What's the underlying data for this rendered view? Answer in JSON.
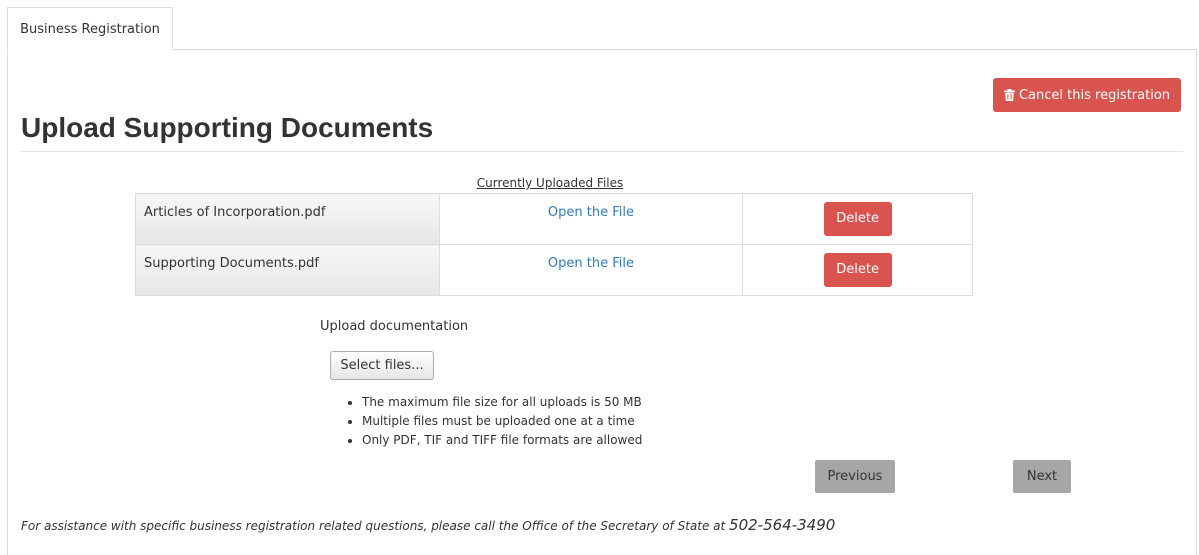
{
  "tab": {
    "label": "Business Registration"
  },
  "header": {
    "title": "Upload Supporting Documents",
    "cancel_label": "Cancel this registration",
    "cancel_icon": "trash-icon"
  },
  "uploaded_files": {
    "caption": "Currently Uploaded Files",
    "rows": [
      {
        "name": "Articles of Incorporation.pdf",
        "link": "Open the File",
        "delete": "Delete"
      },
      {
        "name": "Supporting Documents.pdf",
        "link": "Open the File",
        "delete": "Delete"
      }
    ]
  },
  "upload": {
    "label": "Upload documentation",
    "select_label": "Select files...",
    "rules": [
      "The maximum file size for all uploads is 50 MB",
      "Multiple files must be uploaded one at a time",
      "Only PDF, TIF and TIFF file formats are allowed"
    ]
  },
  "nav": {
    "previous": "Previous",
    "next": "Next"
  },
  "footer": {
    "text": "For assistance with specific business registration related questions, please call the Office of the Secretary of State at ",
    "phone": "502-564-3490"
  },
  "colors": {
    "danger": "#d9534f",
    "link": "#337ab7",
    "nav_button": "#a6a6a6"
  }
}
